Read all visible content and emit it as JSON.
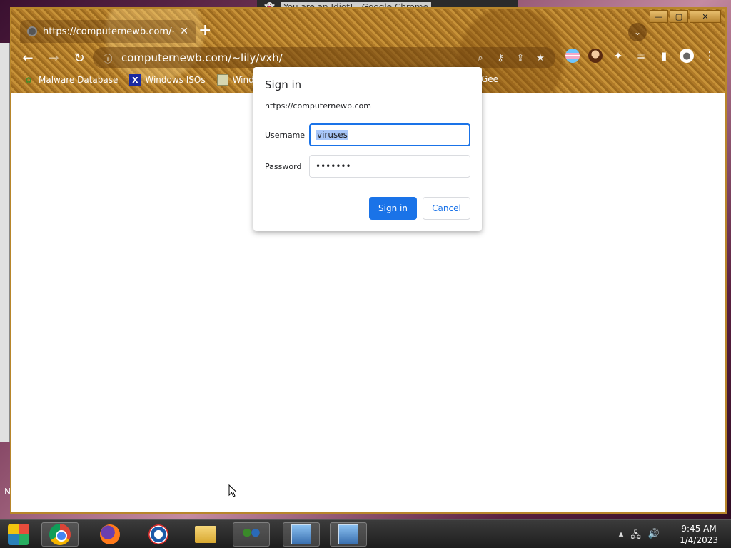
{
  "background_window": {
    "title": "You are an Idiot! - Google Chrome"
  },
  "window_controls": {
    "minimize": "—",
    "maximize": "▢",
    "close": "✕"
  },
  "tab": {
    "title": "https://computernewb.com/~lily/",
    "close": "✕",
    "new_tab": "+"
  },
  "toolbar": {
    "url": "computernewb.com/~lily/vxh/",
    "icons": [
      "back-icon",
      "forward-icon",
      "reload-icon",
      "info-icon",
      "zoom-icon",
      "key-icon",
      "share-icon",
      "star-icon",
      "extensions-icon",
      "media-icon",
      "sidepanel-icon",
      "profile-icon",
      "menu-icon"
    ]
  },
  "bookmarks": {
    "items": [
      {
        "label": "Malware Database",
        "icon": "leaf-icon"
      },
      {
        "label": "Windows ISOs",
        "icon": "x-icon"
      },
      {
        "label": "Windows",
        "icon": "image-icon"
      }
    ],
    "tail": "Gee"
  },
  "dialog": {
    "title": "Sign in",
    "origin": "https://computernewb.com",
    "username_label": "Username",
    "username_value": "viruses",
    "password_label": "Password",
    "password_value": "•••••••",
    "sign_in_button": "Sign in",
    "cancel_button": "Cancel"
  },
  "left_edge_text": "N",
  "taskbar": {
    "apps": [
      "start-button",
      "chrome",
      "firefox",
      "obama-app",
      "file-explorer",
      "users-app",
      "installer-1",
      "installer-2"
    ],
    "clock_time": "9:45 AM",
    "clock_date": "1/4/2023"
  },
  "colors": {
    "accent": "#1a73e8",
    "frame_gold": "#b8862a"
  }
}
